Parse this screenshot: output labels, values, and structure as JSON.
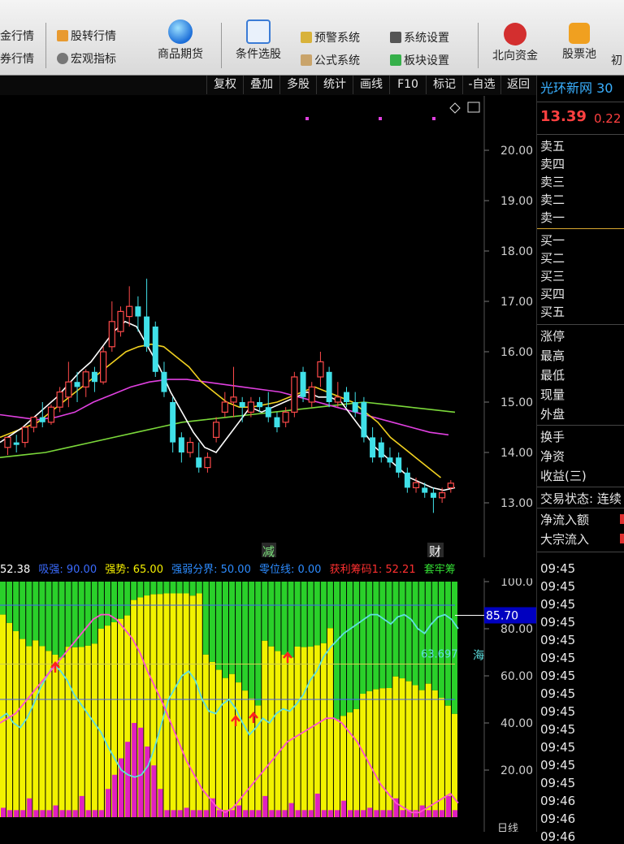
{
  "toolbar": {
    "left_col1": [
      "金行情",
      "券行情"
    ],
    "col2": [
      {
        "icon": "transfer-icon",
        "label": "股转行情"
      },
      {
        "icon": "macro-icon",
        "label": "宏观指标"
      }
    ],
    "futures": {
      "icon": "globe-icon",
      "label": "商品期货"
    },
    "screener": {
      "icon": "screener-icon",
      "label": "条件选股"
    },
    "col5": [
      {
        "icon": "alarm-icon",
        "label": "预警系统"
      },
      {
        "icon": "formula-icon",
        "label": "公式系统"
      }
    ],
    "col6": [
      {
        "icon": "tools-icon",
        "label": "系统设置"
      },
      {
        "icon": "blocks-icon",
        "label": "板块设置"
      }
    ],
    "northbound": {
      "icon": "hongkong-icon",
      "label": "北向资金"
    },
    "ticket_pool": {
      "icon": "wallet-icon",
      "label": "股票池"
    },
    "cut": "初"
  },
  "subbar": [
    "复权",
    "叠加",
    "多股",
    "统计",
    "画线",
    "F10",
    "标记",
    "-自选",
    "返回"
  ],
  "right_panel": {
    "title": "光环新网 30",
    "price": "13.39",
    "change": "0.22",
    "sell_rows": [
      "卖五",
      "卖四",
      "卖三",
      "卖二",
      "卖一"
    ],
    "buy_rows": [
      "买一",
      "买二",
      "买三",
      "买四",
      "买五"
    ],
    "stats_rows": [
      "涨停",
      "最高",
      "最低",
      "现量",
      "外盘"
    ],
    "stats2_rows": [
      "换手",
      "净资",
      "收益(三)"
    ],
    "trade_status": "交易状态: 连续",
    "flow_rows": [
      "净流入额",
      "大宗流入"
    ],
    "times": [
      "09:45",
      "09:45",
      "09:45",
      "09:45",
      "09:45",
      "09:45",
      "09:45",
      "09:45",
      "09:45",
      "09:45",
      "09:45",
      "09:45",
      "09:45",
      "09:46",
      "09:46",
      "09:46"
    ]
  },
  "kline": {
    "y_ticks": [
      "20.00",
      "19.00",
      "18.00",
      "17.00",
      "16.00",
      "15.00",
      "14.00",
      "13.00"
    ],
    "markers": [
      "减",
      "财"
    ],
    "candles": [
      [
        14.1,
        14.3,
        13.95,
        14.2
      ],
      [
        14.2,
        14.15,
        14.0,
        14.35
      ],
      [
        14.2,
        14.5,
        14.1,
        14.45
      ],
      [
        14.5,
        14.7,
        14.4,
        14.65
      ],
      [
        14.7,
        14.6,
        14.5,
        15.0
      ],
      [
        14.6,
        14.9,
        14.55,
        14.95
      ],
      [
        14.9,
        15.2,
        14.8,
        15.3
      ],
      [
        15.1,
        15.4,
        14.9,
        15.8
      ],
      [
        15.4,
        15.3,
        15.0,
        15.6
      ],
      [
        15.3,
        15.6,
        15.1,
        15.65
      ],
      [
        15.6,
        15.4,
        15.2,
        15.7
      ],
      [
        15.4,
        16.0,
        15.35,
        16.1
      ],
      [
        16.1,
        16.6,
        16.0,
        17.0
      ],
      [
        16.4,
        16.8,
        16.3,
        16.9
      ],
      [
        16.7,
        16.9,
        16.5,
        17.3
      ],
      [
        16.9,
        16.7,
        16.4,
        17.1
      ],
      [
        16.7,
        16.1,
        16.0,
        17.45
      ],
      [
        16.5,
        15.6,
        15.5,
        16.6
      ],
      [
        15.6,
        15.2,
        15.1,
        15.8
      ],
      [
        15.0,
        14.2,
        14.0,
        15.1
      ],
      [
        14.3,
        14.0,
        13.8,
        14.4
      ],
      [
        14.0,
        14.2,
        13.9,
        14.3
      ],
      [
        13.9,
        13.7,
        13.6,
        14.2
      ],
      [
        13.7,
        13.9,
        13.6,
        14.0
      ],
      [
        14.3,
        14.6,
        14.2,
        14.7
      ],
      [
        14.8,
        15.0,
        14.7,
        15.2
      ],
      [
        15.0,
        15.1,
        14.7,
        15.7
      ],
      [
        15.0,
        14.9,
        14.6,
        15.1
      ],
      [
        14.8,
        15.0,
        14.7,
        15.1
      ],
      [
        15.0,
        14.9,
        14.8,
        15.1
      ],
      [
        14.9,
        14.7,
        14.6,
        15.2
      ],
      [
        14.7,
        14.5,
        14.4,
        14.8
      ],
      [
        14.6,
        14.8,
        14.5,
        14.9
      ],
      [
        14.8,
        15.5,
        14.7,
        15.6
      ],
      [
        15.6,
        15.1,
        15.0,
        15.7
      ],
      [
        15.0,
        15.3,
        14.9,
        15.4
      ],
      [
        15.5,
        15.8,
        15.3,
        16.0
      ],
      [
        15.6,
        15.0,
        14.9,
        15.7
      ],
      [
        15.0,
        15.1,
        14.9,
        15.4
      ],
      [
        15.2,
        15.0,
        14.9,
        15.3
      ],
      [
        15.0,
        14.8,
        14.7,
        15.2
      ],
      [
        15.0,
        14.3,
        14.2,
        15.1
      ],
      [
        14.3,
        13.9,
        13.8,
        14.5
      ],
      [
        14.2,
        13.9,
        13.8,
        14.3
      ],
      [
        13.9,
        13.8,
        13.7,
        14.1
      ],
      [
        13.9,
        13.6,
        13.5,
        14.0
      ],
      [
        13.6,
        13.3,
        13.2,
        13.7
      ],
      [
        13.3,
        13.4,
        13.2,
        13.5
      ],
      [
        13.3,
        13.2,
        13.1,
        13.4
      ],
      [
        13.2,
        13.1,
        12.8,
        13.3
      ],
      [
        13.1,
        13.2,
        13.0,
        13.3
      ],
      [
        13.3,
        13.39,
        13.2,
        13.45
      ]
    ],
    "ma_white": [
      14.2,
      14.35,
      14.5,
      14.7,
      14.9,
      15.1,
      15.35,
      15.6,
      15.8,
      16.1,
      16.4,
      16.6,
      16.5,
      16.1,
      15.7,
      15.2,
      14.8,
      14.4,
      14.1,
      14.0,
      14.3,
      14.6,
      14.9,
      14.8,
      14.9,
      15.0,
      15.1,
      15.2,
      15.1,
      15.1,
      15.0,
      14.7,
      14.4,
      14.1,
      13.9,
      13.7,
      13.5,
      13.4,
      13.3,
      13.25,
      13.3
    ],
    "ma_yellow": [
      14.3,
      14.4,
      14.5,
      14.6,
      14.8,
      15.0,
      15.2,
      15.4,
      15.6,
      15.8,
      16.0,
      16.1,
      16.15,
      16.1,
      15.9,
      15.7,
      15.4,
      15.2,
      15.0,
      14.9,
      14.9,
      14.95,
      15.0,
      15.1,
      15.2,
      15.3,
      15.2,
      15.1,
      15.0,
      14.8,
      14.6,
      14.3,
      14.1,
      13.9,
      13.7,
      13.5
    ],
    "ma_magenta": [
      14.75,
      14.7,
      14.65,
      14.7,
      14.8,
      15.0,
      15.15,
      15.3,
      15.4,
      15.45,
      15.45,
      15.4,
      15.35,
      15.3,
      15.25,
      15.2,
      15.1,
      15.0,
      14.9,
      14.8,
      14.7,
      14.6,
      14.5,
      14.4,
      14.35
    ],
    "ma_green": [
      13.9,
      13.95,
      14.0,
      14.1,
      14.2,
      14.3,
      14.4,
      14.5,
      14.6,
      14.65,
      14.7,
      14.75,
      14.8,
      14.85,
      14.9,
      14.95,
      15.0,
      14.95,
      14.9,
      14.85,
      14.8
    ]
  },
  "indicator": {
    "label_val": "52.38",
    "xiqiang": "吸强: 90.00",
    "qiangshi": "强势: 65.00",
    "fenjie": "强弱分界: 50.00",
    "zero": "零位线: 0.00",
    "huoli": "获利筹码1: 52.21",
    "taolao": "套牢筹",
    "y_ticks": [
      "100.0",
      "80.00",
      "60.00",
      "40.00",
      "20.00"
    ],
    "current_tag": "85.70",
    "cyan_label": "63.697",
    "cyan_name": "海",
    "bottom_cut": "日线",
    "cyan": [
      42,
      44,
      40,
      38,
      42,
      48,
      55,
      60,
      65,
      62,
      58,
      52,
      48,
      44,
      40,
      36,
      30,
      25,
      20,
      18,
      17,
      18,
      22,
      30,
      40,
      50,
      55,
      60,
      62,
      58,
      50,
      45,
      44,
      48,
      50,
      46,
      40,
      35,
      38,
      42,
      40,
      44,
      46,
      45,
      48,
      52,
      58,
      62,
      68,
      72,
      75,
      78,
      80,
      82,
      84,
      86,
      86,
      84,
      82,
      85,
      86,
      84,
      80,
      78,
      82,
      85,
      86,
      84,
      80
    ],
    "magenta": [
      40,
      42,
      44,
      48,
      52,
      56,
      60,
      64,
      68,
      72,
      76,
      80,
      84,
      86,
      86,
      84,
      80,
      76,
      70,
      62,
      55,
      48,
      40,
      32,
      24,
      18,
      12,
      8,
      4,
      2,
      4,
      8,
      12,
      16,
      20,
      24,
      28,
      32,
      34,
      36,
      38,
      40,
      42,
      42,
      40,
      36,
      32,
      26,
      20,
      14,
      10,
      6,
      4,
      2,
      2,
      4,
      6,
      8,
      10,
      6
    ]
  }
}
